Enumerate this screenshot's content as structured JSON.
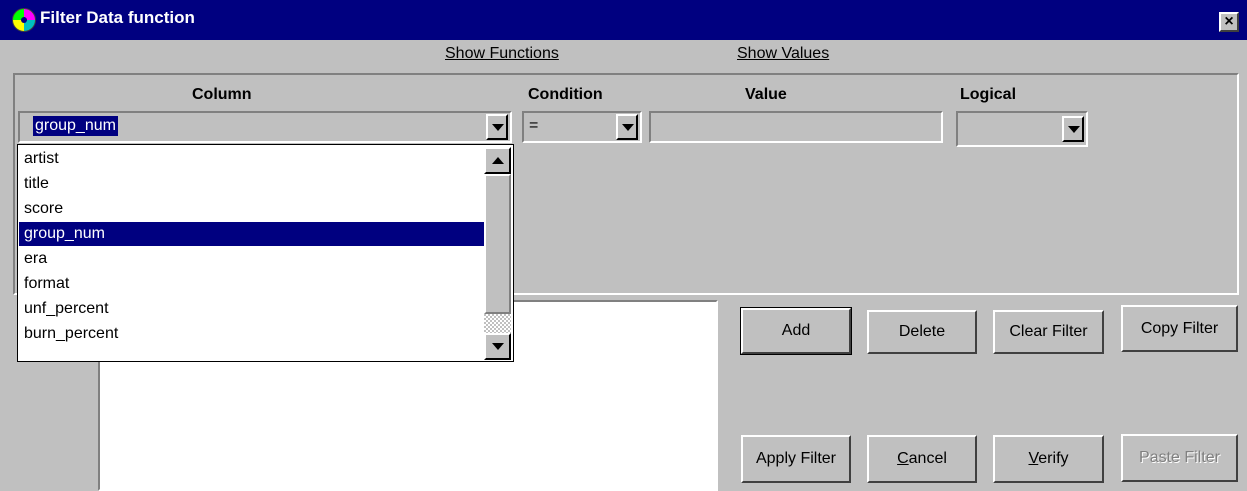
{
  "window": {
    "title": "Filter Data function",
    "close_label": "×"
  },
  "links": {
    "show_functions": "Show Functions",
    "show_values": "Show Values"
  },
  "headers": {
    "column": "Column",
    "condition": "Condition",
    "value": "Value",
    "logical": "Logical"
  },
  "criteria": {
    "column_value": "group_num",
    "condition_value": "=",
    "value": "",
    "logical": ""
  },
  "column_options": [
    "artist",
    "title",
    "score",
    "group_num",
    "era",
    "format",
    "unf_percent",
    "burn_percent"
  ],
  "selected_option": "group_num",
  "buttons": {
    "add": "Add",
    "delete": "Delete",
    "clear_filter": "Clear Filter",
    "copy_filter": "Copy Filter",
    "apply_filter": "Apply Filter",
    "cancel_first": "C",
    "cancel_rest": "ancel",
    "verify_first": "V",
    "verify_rest": "erify",
    "paste_filter": "Paste Filter"
  },
  "colors": {
    "titlebar": "#000080",
    "face": "#c0c0c0",
    "selection": "#000080"
  }
}
